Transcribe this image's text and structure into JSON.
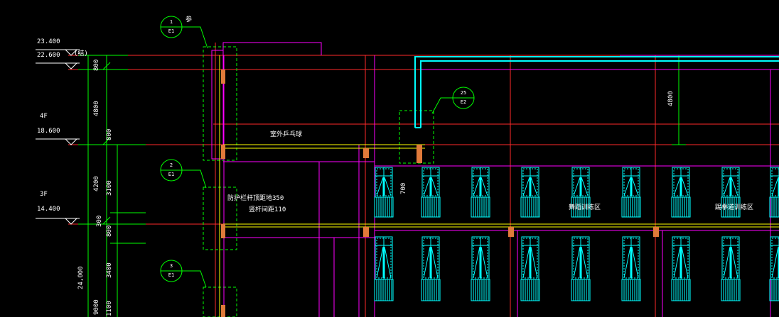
{
  "levels": {
    "roof_top": "23.400",
    "roof": "22.600",
    "roof_note": "(结)",
    "floor4_name": "4F",
    "floor4_elev": "18.600",
    "floor3_name": "3F",
    "floor3_elev": "14.400"
  },
  "dims": {
    "d800a": "800",
    "d4800a": "4800",
    "d800b": "800",
    "d4200": "4200",
    "d3100": "3100",
    "d300": "300",
    "d800c": "800",
    "d3400": "3400",
    "d24000": "24,000",
    "d9000": "9000",
    "d1100": "1100",
    "d700": "700",
    "d4800b": "4800"
  },
  "callouts": [
    {
      "num": "1",
      "sheet": "E1",
      "note": "参"
    },
    {
      "num": "2",
      "sheet": "E1"
    },
    {
      "num": "3",
      "sheet": "E1"
    },
    {
      "num": "25",
      "sheet": "E2"
    }
  ],
  "labels": {
    "terrace": "室外乒乓球",
    "railing1": "防护栏杆顶距地350",
    "railing2": "竖杆间距110",
    "area1": "舞蹈训练区",
    "area2": "踢拳道训练区"
  },
  "colors": {
    "background": "#000000",
    "red": "#ff2a2a",
    "green": "#00ff00",
    "magenta": "#ff00ff",
    "cyan": "#00ffff",
    "yellow": "#ffff00",
    "orange": "#e07a3a",
    "white": "#ffffff"
  }
}
